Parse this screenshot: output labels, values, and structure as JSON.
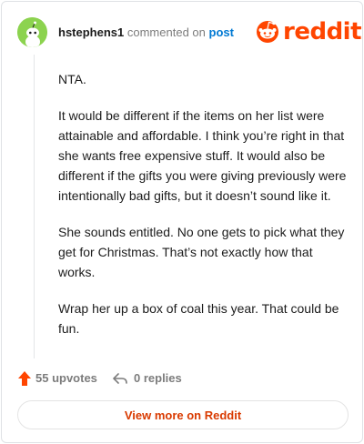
{
  "header": {
    "author": "hstephens1",
    "commented_text": "commented on",
    "post_link": "post",
    "logo_text": "reddit",
    "avatar_icon": "snoo-avatar-icon",
    "logo_icon": "reddit-snoo-icon"
  },
  "comment": {
    "paragraphs": [
      "NTA.",
      "It would be different if the items on her list were attainable and affordable. I think you’re right in that she wants free expensive stuff. It would also be different if the gifts you were giving previously were intentionally bad gifts, but it doesn’t sound like it.",
      "She sounds entitled. No one gets to pick what they get for Christmas. That’s not exactly how that works.",
      "Wrap her up a box of coal this year. That could be fun."
    ]
  },
  "actions": {
    "upvotes_label": "55 upvotes",
    "replies_label": "0 replies",
    "upvote_icon": "upvote-arrow-icon",
    "reply_icon": "reply-arrow-icon"
  },
  "footer": {
    "view_more_label": "View more on Reddit"
  },
  "colors": {
    "brand": "#ff4500",
    "link": "#0079d3",
    "view_more": "#d93a00",
    "avatar_bg": "#8cd34f"
  }
}
